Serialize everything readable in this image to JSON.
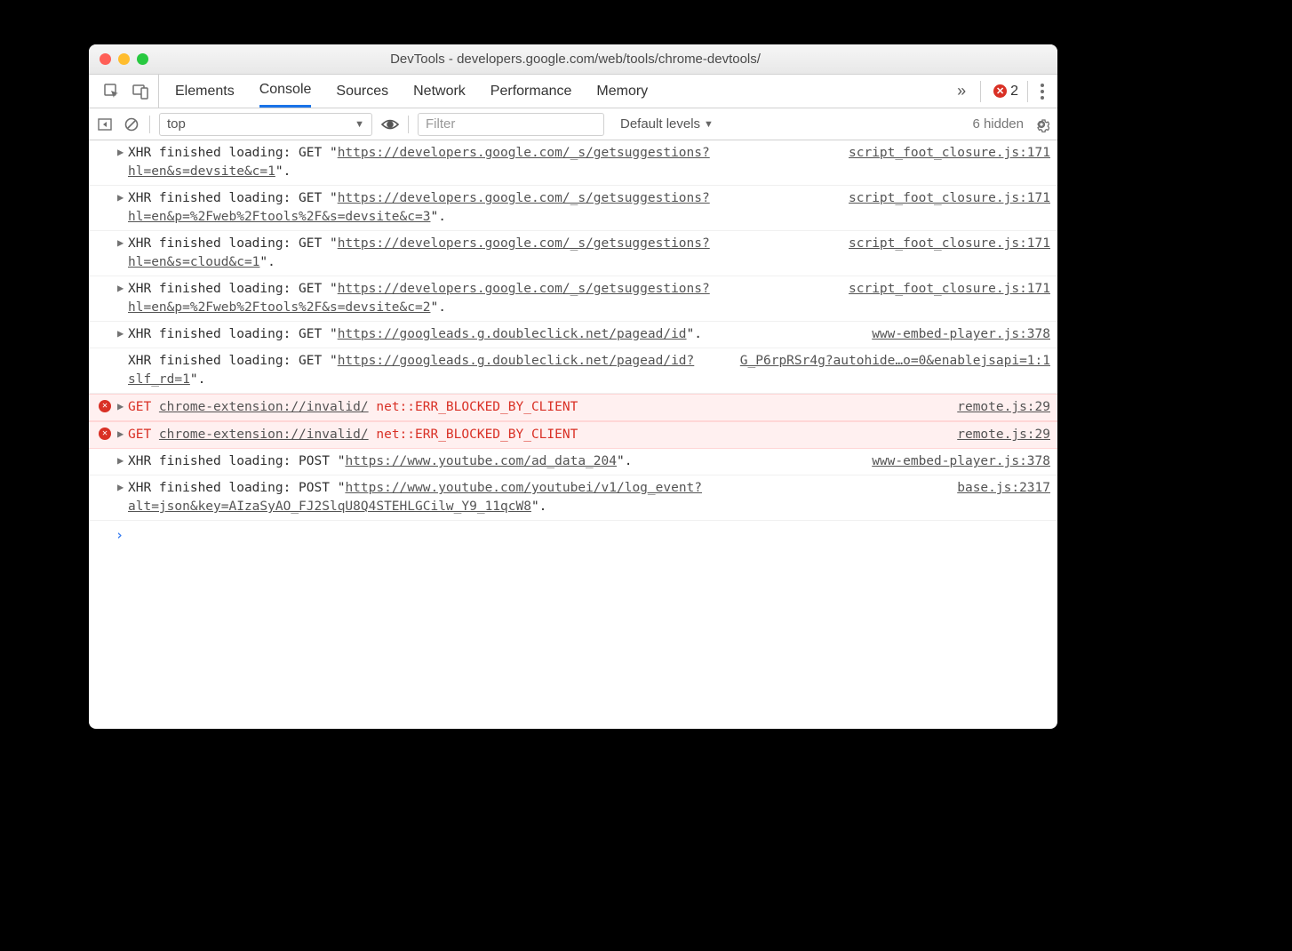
{
  "window": {
    "title": "DevTools - developers.google.com/web/tools/chrome-devtools/"
  },
  "tabs": {
    "items": [
      "Elements",
      "Console",
      "Sources",
      "Network",
      "Performance",
      "Memory"
    ],
    "active": "Console",
    "overflow_glyph": "»",
    "error_count": "2"
  },
  "toolbar": {
    "context": "top",
    "context_arrow": "▼",
    "filter_placeholder": "Filter",
    "levels_label": "Default levels",
    "levels_arrow": "▼",
    "hidden_label": "6 hidden"
  },
  "messages": [
    {
      "type": "log",
      "expandable": true,
      "prefix": "XHR finished loading: GET \"",
      "url": "https://developers.google.com/_s/getsuggestions?hl=en&s=devsite&c=1",
      "suffix": "\".",
      "source": "script_foot_closure.js:171"
    },
    {
      "type": "log",
      "expandable": true,
      "prefix": "XHR finished loading: GET \"",
      "url": "https://developers.google.com/_s/getsuggestions?hl=en&p=%2Fweb%2Ftools%2F&s=devsite&c=3",
      "suffix": "\".",
      "source": "script_foot_closure.js:171"
    },
    {
      "type": "log",
      "expandable": true,
      "prefix": "XHR finished loading: GET \"",
      "url": "https://developers.google.com/_s/getsuggestions?hl=en&s=cloud&c=1",
      "suffix": "\".",
      "source": "script_foot_closure.js:171"
    },
    {
      "type": "log",
      "expandable": true,
      "prefix": "XHR finished loading: GET \"",
      "url": "https://developers.google.com/_s/getsuggestions?hl=en&p=%2Fweb%2Ftools%2F&s=devsite&c=2",
      "suffix": "\".",
      "source": "script_foot_closure.js:171"
    },
    {
      "type": "log",
      "expandable": true,
      "prefix": "XHR finished loading: GET \"",
      "url": "https://googleads.g.doubleclick.net/pagead/id",
      "suffix": "\".",
      "source": "www-embed-player.js:378"
    },
    {
      "type": "log",
      "expandable": false,
      "prefix": "XHR finished loading: GET \"",
      "url": "https://googleads.g.doubleclick.net/pagead/id?slf_rd=1",
      "suffix": "\".",
      "source": "G_P6rpRSr4g?autohide…o=0&enablejsapi=1:1"
    },
    {
      "type": "error",
      "expandable": true,
      "method": "GET",
      "err_url": "chrome-extension://invalid/",
      "status": "net::ERR_BLOCKED_BY_CLIENT",
      "source": "remote.js:29"
    },
    {
      "type": "error",
      "expandable": true,
      "method": "GET",
      "err_url": "chrome-extension://invalid/",
      "status": "net::ERR_BLOCKED_BY_CLIENT",
      "source": "remote.js:29"
    },
    {
      "type": "log",
      "expandable": true,
      "prefix": "XHR finished loading: POST \"",
      "url": "https://www.youtube.com/ad_data_204",
      "suffix": "\".",
      "source": "www-embed-player.js:378"
    },
    {
      "type": "log",
      "expandable": true,
      "prefix": "XHR finished loading: POST \"",
      "url": "https://www.youtube.com/youtubei/v1/log_event?alt=json&key=AIzaSyAO_FJ2SlqU8Q4STEHLGCilw_Y9_11qcW8",
      "suffix": "\".",
      "source": "base.js:2317"
    }
  ],
  "prompt": {
    "glyph": "›"
  }
}
